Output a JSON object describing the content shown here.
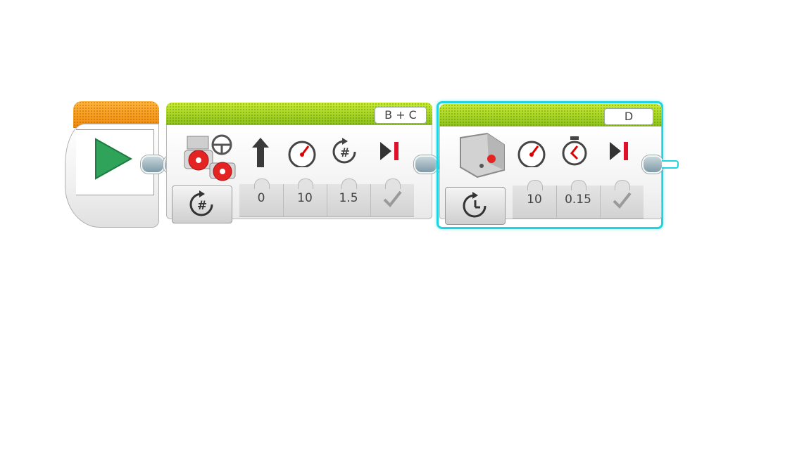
{
  "blocks": {
    "steering": {
      "ports": "B + C",
      "params": [
        "0",
        "10",
        "1.5"
      ]
    },
    "medium_motor": {
      "port": "D",
      "params": [
        "10",
        "0.15"
      ]
    }
  },
  "colors": {
    "start_orange": "#f7a11a",
    "action_green": "#8cc11b",
    "selection_cyan": "#1fd4e0",
    "play_green": "#2fa35a"
  },
  "icons": {
    "start": "play-icon",
    "steering_mode": "rotations-mode-icon",
    "medium_mode": "seconds-mode-icon",
    "steering_param_icons": [
      "steering-arrow-icon",
      "power-gauge-icon",
      "rotations-icon",
      "brake-icon"
    ],
    "medium_param_icons": [
      "power-gauge-icon",
      "timer-icon",
      "brake-icon"
    ]
  }
}
